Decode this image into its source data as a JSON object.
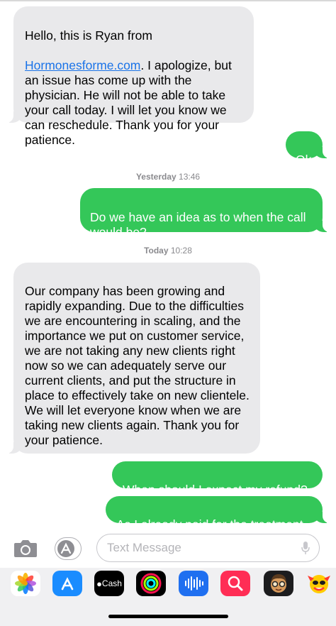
{
  "messages": [
    {
      "pre": "Hello, this is Ryan from",
      "link": "Hormonesforme.com",
      "post": ".  I apologize, but an issue has come up with the physician.  He will not be able to take your call today. I will let you know we can reschedule.  Thank you for your patience."
    },
    {
      "text": "Ok"
    },
    {
      "text": "Do we have an idea as to when the call would be?"
    },
    {
      "text": "Our company has been growing and rapidly expanding.  Due to the difficulties we are encountering in scaling, and the importance we put on customer service, we are not taking any new clients right now so we can adequately serve our current clients, and put the structure in place to effectively take on new clientele.  We will let everyone know when we are taking new clients again.  Thank you for your patience."
    },
    {
      "text": "When should I expect my refund?"
    },
    {
      "text": "As I already paid for the treatment"
    }
  ],
  "timestamps": {
    "yesterday_label": "Yesterday",
    "yesterday_time": "13:46",
    "today_label": "Today",
    "today_time": "10:28"
  },
  "composer": {
    "placeholder": "Text Message",
    "camera_icon": "camera-icon",
    "apps_icon": "app-store-icon",
    "mic_icon": "microphone-icon"
  },
  "app_drawer": {
    "cash_label": "Cash",
    "apps": [
      "photos-icon",
      "app-store-icon",
      "apple-cash-icon",
      "activity-icon",
      "audio-message-icon",
      "images-search-icon",
      "memoji-icon",
      "animoji-icon"
    ]
  },
  "colors": {
    "sent_bubble": "#34c759",
    "received_bubble": "#e9e9eb",
    "link": "#1a73e8"
  }
}
